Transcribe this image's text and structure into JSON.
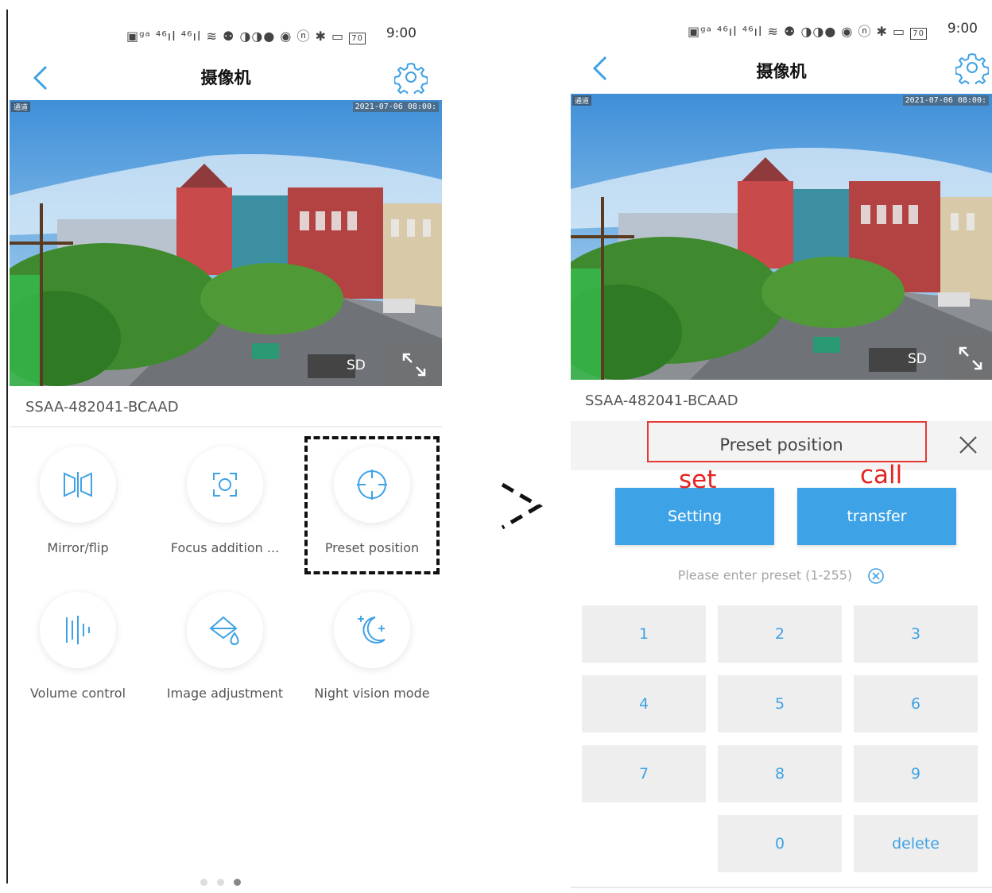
{
  "status_bar": {
    "icons": "▣ᵍᵃ ⁴⁶ıl ⁴⁶ıl ≋ ⚉ ◑◑● ◉ ⓝ ✱ ▭",
    "battery": "70",
    "time": "9:00"
  },
  "nav": {
    "title": "摄像机",
    "back_icon": "chevron-left-icon",
    "settings_icon": "gear-icon"
  },
  "video": {
    "timestamp": "2021-07-06 08:00:",
    "channel_tag": "通道",
    "quality_label": "SD",
    "expand_icon": "expand-icon"
  },
  "device": {
    "name": "SSAA-482041-BCAAD"
  },
  "features": [
    {
      "label": "Mirror/flip",
      "icon": "mirror-flip-icon"
    },
    {
      "label": "Focus addition ...",
      "icon": "focus-icon"
    },
    {
      "label": "Preset position",
      "icon": "crosshair-icon"
    },
    {
      "label": "Volume control",
      "icon": "volume-bars-icon"
    },
    {
      "label": "Image adjustment",
      "icon": "image-adjust-icon"
    },
    {
      "label": "Night vision mode",
      "icon": "moon-stars-icon"
    }
  ],
  "pager": {
    "pages": 3,
    "active": 3
  },
  "preset_panel": {
    "title": "Preset position",
    "annotation_set": "set",
    "annotation_call": "call",
    "setting_button": "Setting",
    "transfer_button": "transfer",
    "hint": "Please enter preset (1-255)",
    "keys": [
      "1",
      "2",
      "3",
      "4",
      "5",
      "6",
      "7",
      "8",
      "9",
      "0",
      "delete"
    ]
  },
  "colors": {
    "accent": "#3ea2e6",
    "annotation_red": "#e52421",
    "key_bg": "#eeeeee"
  }
}
